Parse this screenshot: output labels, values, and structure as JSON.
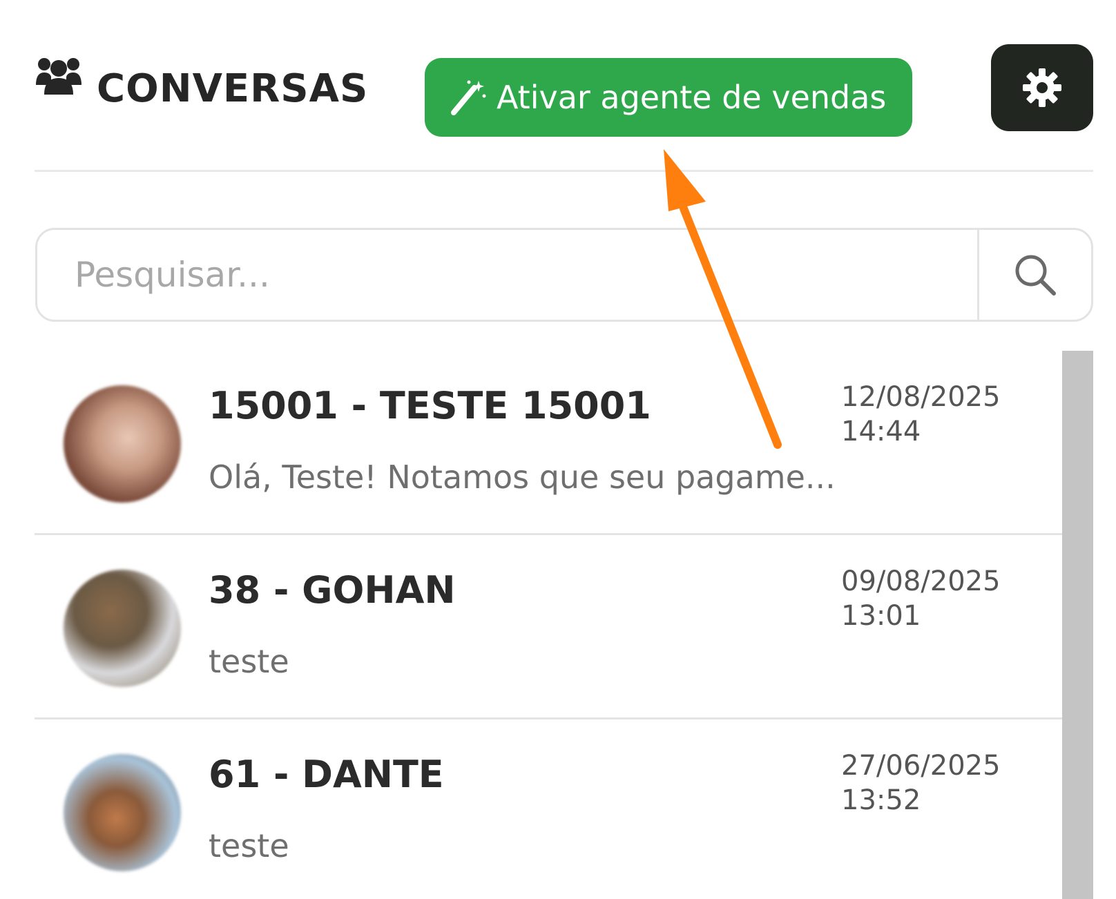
{
  "header": {
    "title": "CONVERSAS",
    "activate_button_label": "Ativar agente de vendas",
    "settings_icon": "gear-icon",
    "users_icon": "users-icon",
    "accent_color": "#2ea84a"
  },
  "search": {
    "placeholder": "Pesquisar...",
    "value": ""
  },
  "conversations": [
    {
      "name": "15001 - TESTE 15001",
      "preview": "Olá, Teste! Notamos que seu pagame...",
      "date": "12/08/2025",
      "time": "14:44"
    },
    {
      "name": "38 - GOHAN",
      "preview": "teste",
      "date": "09/08/2025",
      "time": "13:01"
    },
    {
      "name": "61 - DANTE",
      "preview": "teste",
      "date": "27/06/2025",
      "time": "13:52"
    }
  ],
  "annotation": {
    "arrow_color": "#ff7f0e"
  }
}
